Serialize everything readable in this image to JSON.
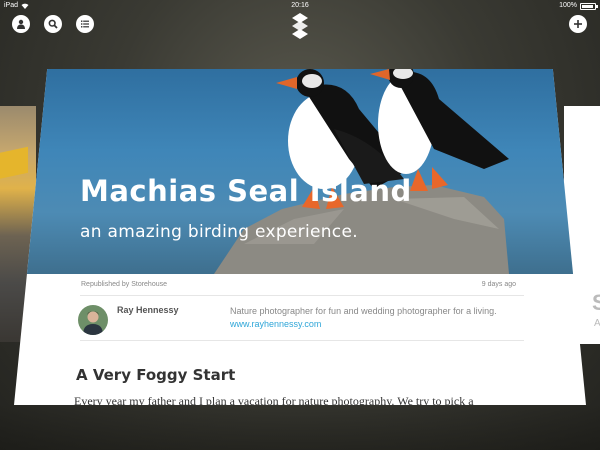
{
  "status_bar": {
    "carrier": "iPad",
    "time": "20:16",
    "battery_percent": "100%"
  },
  "toolbar": {
    "profile_icon": "person-icon",
    "search_icon": "search-icon",
    "menu_icon": "list-icon",
    "logo_icon": "storehouse-logo-icon",
    "add_icon": "plus-icon"
  },
  "story": {
    "title": "Machias Seal Island",
    "subtitle": "an amazing birding experience.",
    "republished": "Republished by Storehouse",
    "age": "9 days ago",
    "author_name": "Ray Hennessy",
    "author_bio": "Nature photographer for fun and wedding photographer for a living.",
    "author_link": "www.rayhennessy.com",
    "section_title": "A Very Foggy Start",
    "body_first_line": "Every year my father and I plan a vacation for nature photography.  We try to pick a"
  },
  "colors": {
    "link": "#2fa6d8",
    "sky": "#3f86b8",
    "background": "#3a3a33"
  }
}
